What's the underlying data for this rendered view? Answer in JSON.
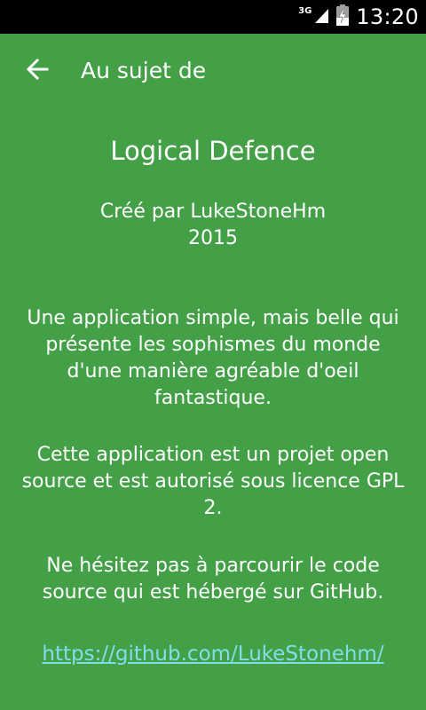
{
  "status_bar": {
    "network_type": "3G",
    "signal_icon": "signal-icon",
    "battery_icon": "battery-charging-icon",
    "time": "13:20"
  },
  "app_bar": {
    "back_icon": "arrow-back-icon",
    "title": "Au sujet de"
  },
  "about": {
    "app_name": "Logical Defence",
    "created_by": "Créé par LukeStoneHm",
    "year": "2015",
    "description": "Une application simple, mais belle qui présente les sophismes du monde d'une manière agréable d'oeil fantastique.",
    "license": "Cette application est un projet open source et est autorisé sous licence GPL 2.",
    "source_invite": "Ne hésitez pas à parcourir le code source qui est hébergé sur GitHub.",
    "repo_link": "https://github.com/LukeStonehm/"
  },
  "colors": {
    "background": "#43a047",
    "status_bar": "#000000",
    "text": "#ffffff",
    "link": "#80deea"
  }
}
